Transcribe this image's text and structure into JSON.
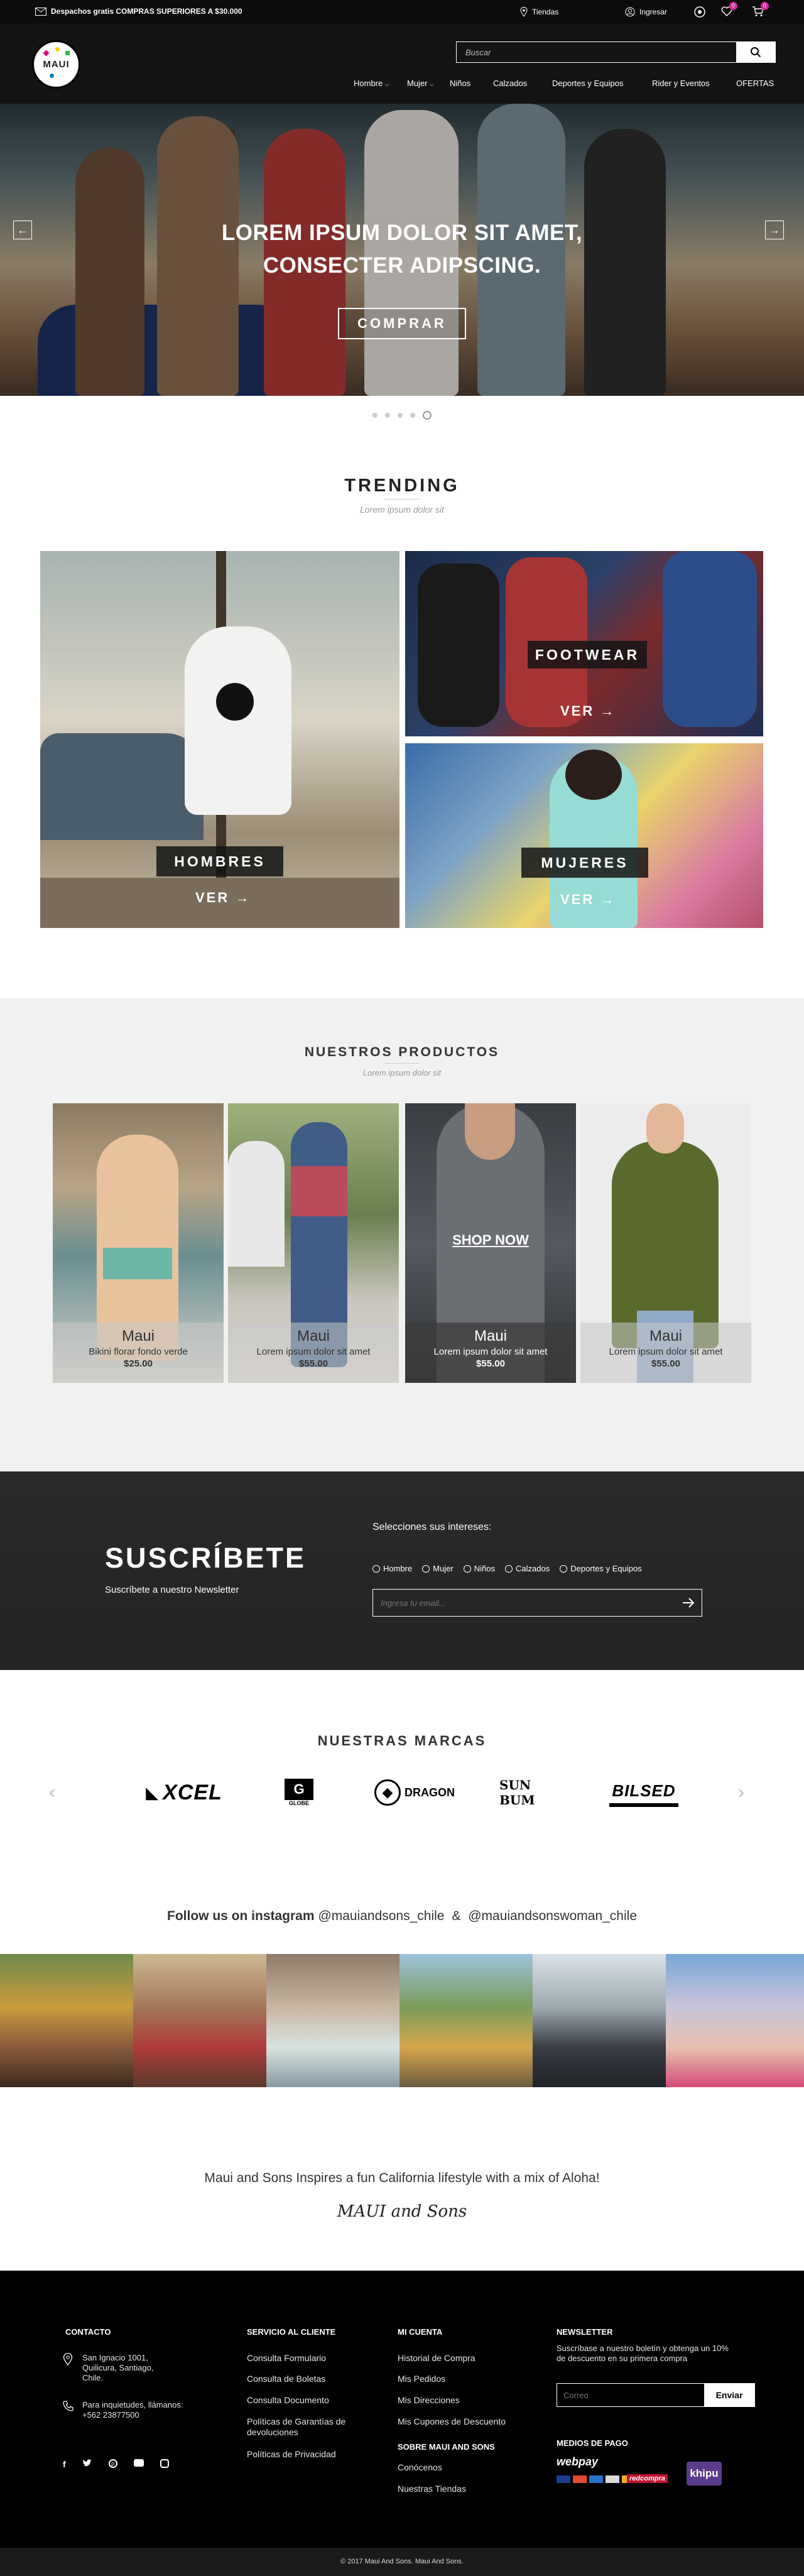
{
  "topbar": {
    "shipping": "Despachos gratis COMPRAS SUPERIORES A $30.000",
    "stores": "Tiendas",
    "login": "Ingresar",
    "wishlist_count": "0",
    "cart_count": "0"
  },
  "header": {
    "logo_text": "MAUI",
    "search_placeholder": "Buscar",
    "nav": [
      "Hombre",
      "Mujer",
      "Niños",
      "Calzados",
      "Deportes y Equipos",
      "Rider y Eventos",
      "OFERTAS"
    ]
  },
  "hero": {
    "title_line1": "LOREM IPSUM DOLOR SIT AMET,",
    "title_line2": "CONSECTER ADIPSCING.",
    "button": "COMPRAR",
    "prev": "←",
    "next": "→"
  },
  "trending": {
    "title": "TRENDING",
    "subtitle": "Lorem ipsum dolor sit",
    "tiles": [
      {
        "label": "HOMBRES",
        "link": "VER →"
      },
      {
        "label": "FOOTWEAR",
        "link": "VER →"
      },
      {
        "label": "MUJERES",
        "link": "VER →"
      }
    ]
  },
  "products": {
    "title": "NUESTROS PRODUCTOS",
    "subtitle": "Lorem ipsum dolor sit",
    "shop_now": "SHOP NOW",
    "items": [
      {
        "brand": "Maui",
        "desc": "Bikini florar fondo verde",
        "price": "$25.00"
      },
      {
        "brand": "Maui",
        "desc": "Lorem ipsum dolor sit amet",
        "price": "$55.00"
      },
      {
        "brand": "Maui",
        "desc": "Lorem ipsum dolor sit amet",
        "price": "$55.00"
      },
      {
        "brand": "Maui",
        "desc": "Lorem ipsum dolor sit amet",
        "price": "$55.00"
      }
    ]
  },
  "subscribe": {
    "title": "SUSCRÍBETE",
    "subtitle": "Suscríbete a nuestro Newsletter",
    "interests_label": "Selecciones sus intereses:",
    "options": [
      "Hombre",
      "Mujer",
      "Niños",
      "Calzados",
      "Deportes y Equipos"
    ],
    "email_placeholder": "Ingresa tu email..."
  },
  "brands": {
    "title": "NUESTRAS MARCAS",
    "logos": [
      "XCEL",
      "GLOBE",
      "DRAGON",
      "SUN BUM",
      "BILSED"
    ]
  },
  "instagram": {
    "prefix": "Follow us on",
    "bold": "instagram",
    "handle1": "@mauiandsons_chile",
    "amp": "&",
    "handle2": "@mauiandsonswoman_chile"
  },
  "tagline": {
    "text": "Maui and Sons Inspires a fun California lifestyle with a mix of Aloha!",
    "signature": "MAUI and Sons"
  },
  "footer": {
    "contact": {
      "title": "CONTACTO",
      "address": "San Ignacio 1001, Quilicura, Santiago, Chile.",
      "phone_label": "Para inquietudes, llámanos:",
      "phone": "+562 23877500"
    },
    "service": {
      "title": "SERVICIO AL CLIENTE",
      "links": [
        "Consulta Formulario",
        "Consulta de Boletas",
        "Consulta Documento",
        "Políticas de Garantías de devoluciones",
        "Políticas de Privacidad"
      ]
    },
    "account": {
      "title": "MI CUENTA",
      "links": [
        "Historial de Compra",
        "Mis Pedidos",
        "Mis Direcciones",
        "Mis Cupones de Descuento"
      ],
      "about_title": "SOBRE MAUI AND SONS",
      "about_links": [
        "Conócenos",
        "Nuestras Tiendas"
      ]
    },
    "newsletter": {
      "title": "NEWSLETTER",
      "text": "Suscríbase a nuestro boletín y obtenga un 10% de descuento en su primera compra",
      "placeholder": "Correo",
      "button": "Enviar",
      "payments_title": "MEDIOS DE PAGO",
      "payments": [
        "webpay",
        "khipu",
        "redcompra"
      ]
    },
    "copyright": "© 2017 Maui And Sons. Maui And Sons."
  }
}
